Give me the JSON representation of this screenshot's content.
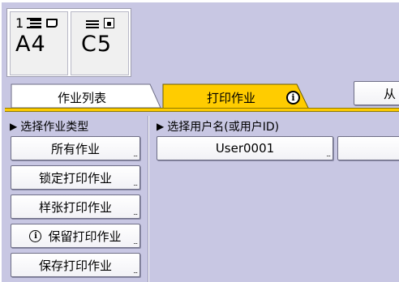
{
  "trays": [
    {
      "number": "1",
      "size": "A4"
    },
    {
      "size": "C5"
    }
  ],
  "tabs": {
    "job_list": "作业列表",
    "print_jobs": "打印作业"
  },
  "top_right_button": "从",
  "left_section": {
    "label": "选择作业类型",
    "buttons": [
      {
        "label": "所有作业"
      },
      {
        "label": "锁定打印作业"
      },
      {
        "label": "样张打印作业"
      },
      {
        "label": "保留打印作业"
      },
      {
        "label": "保存打印作业"
      }
    ]
  },
  "right_section": {
    "label": "选择用户名(或用户ID)",
    "users": [
      "User0001",
      ""
    ]
  },
  "colors": {
    "background": "#c8c7e3",
    "active_tab": "#ffcc00",
    "inactive_tab": "#ffffff"
  },
  "icons": {
    "tray1": [
      "paper-stack-icon",
      "sheet-icon"
    ],
    "tray2": [
      "envelope-stack-icon",
      "lock-icon"
    ],
    "tab_info": "info-icon",
    "hold_info": "info-icon"
  }
}
